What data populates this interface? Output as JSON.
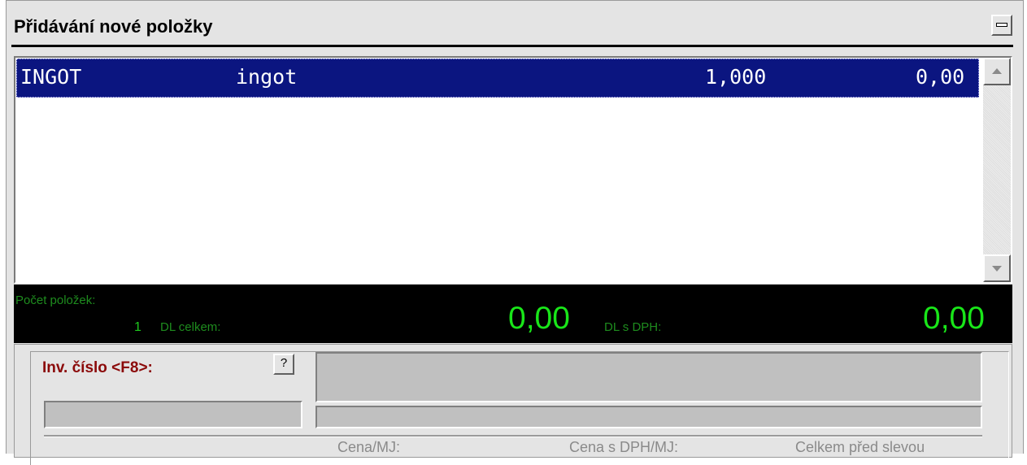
{
  "window": {
    "title": "Přidávání nové položky"
  },
  "list": {
    "rows": [
      {
        "code": "INGOT",
        "name": "ingot",
        "quantity": "1,000",
        "price": "0,00"
      }
    ]
  },
  "summary": {
    "count_label": "Počet položek:",
    "count_value": "1",
    "dl_total_label": "DL celkem:",
    "dl_total_value": "0,00",
    "dl_vat_label": "DL s DPH:",
    "dl_vat_value": "0,00"
  },
  "form": {
    "inv_label": "Inv. číslo <F8>:",
    "help_label": "?",
    "columns": {
      "price_per_unit": "Cena/MJ:",
      "price_vat_per_unit": "Cena s DPH/MJ:",
      "total_before_discount": "Celkem před slevou"
    }
  },
  "colors": {
    "selection": "#0b1580",
    "summary_bg": "#000000",
    "summary_value": "#19e619",
    "summary_label": "#1e8c1e",
    "inv_label": "#8b0a0a"
  }
}
